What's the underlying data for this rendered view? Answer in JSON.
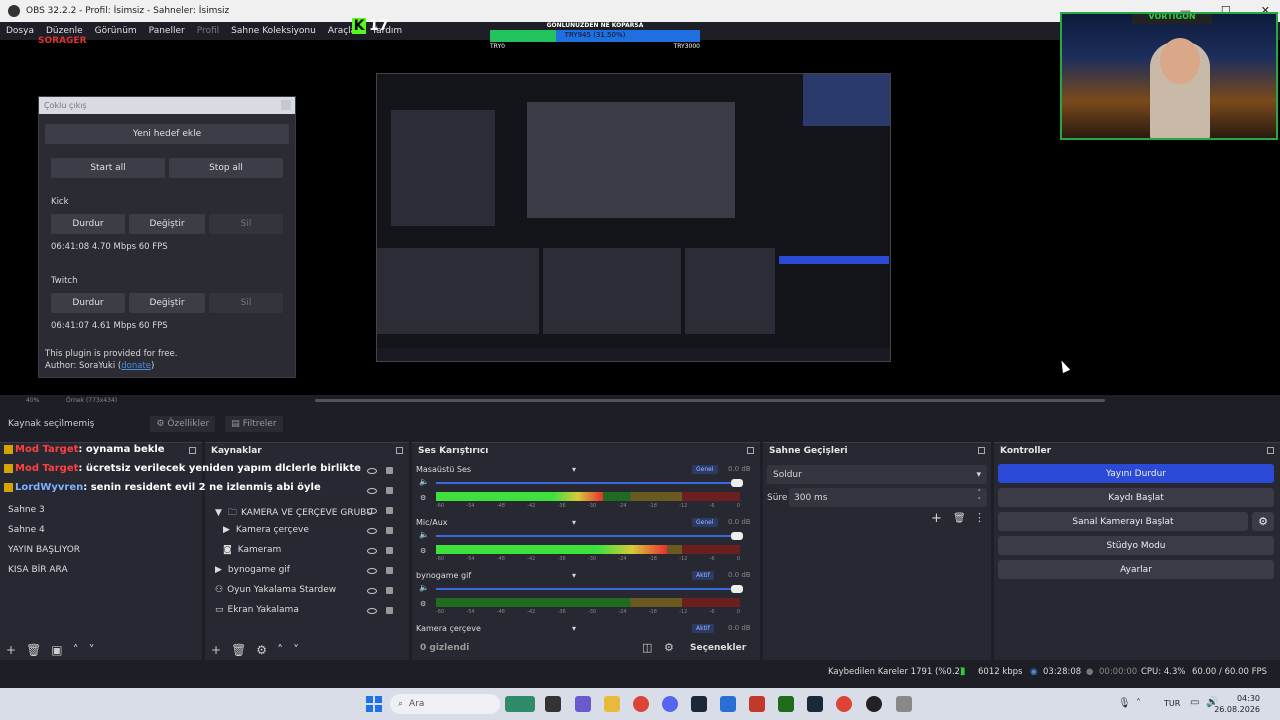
{
  "window": {
    "title": "OBS 32.2.2 - Profil: İsimsiz - Sahneler: İsimsiz"
  },
  "menu": [
    "Dosya",
    "Düzenle",
    "Görünüm",
    "Paneller",
    "Profil",
    "Sahne Koleksiyonu",
    "Araçlar",
    "Yardım"
  ],
  "overlay": {
    "watermark": "SORAGER",
    "kick_count": "17",
    "goal_title": "GÖNLÜNÜZDEN NE KOPARSA",
    "goal_bar_text": "TRY945 (31.50%)",
    "goal_fraction": 0.315,
    "goal_start": "TRY0",
    "goal_end": "TRY3000",
    "webcam_label": "VORTIGON"
  },
  "multi_output": {
    "title": "Çoklu çıkış",
    "add_target": "Yeni hedef ekle",
    "start_all": "Start all",
    "stop_all": "Stop all",
    "targets": [
      {
        "name": "Kick",
        "stop": "Durdur",
        "edit": "Değiştir",
        "delete": "Sil",
        "status": "06:41:08  4.70 Mbps  60 FPS"
      },
      {
        "name": "Twitch",
        "stop": "Durdur",
        "edit": "Değiştir",
        "delete": "Sil",
        "status": "06:41:07  4.61 Mbps  60 FPS"
      }
    ],
    "footer_line1": "This plugin is provided for free.",
    "footer_author": "Author: SoraYuki (",
    "footer_link": "donate",
    "footer_close": ")"
  },
  "zoom": {
    "level": "40%",
    "canvas": "Örnek (773x434)"
  },
  "source_toolbar": {
    "no_source": "Kaynak seçilmemiş",
    "properties": "Özellikler",
    "filters": "Filtreler"
  },
  "chat": [
    {
      "user": "Mod Target",
      "msg": ": oynama bekle"
    },
    {
      "user": "Mod Target",
      "msg": ": ücretsiz verilecek yeniden yapım dlclerle birlikte"
    },
    {
      "user": "LordWyvren",
      "msg": ": senin resident evil 2 ne izlenmiş abi öyle"
    }
  ],
  "scenes": [
    "Sahne 3",
    "Sahne 4",
    "YAYIN BAŞLIYOR",
    "KISA BİR ARA"
  ],
  "sources": {
    "title": "Kaynaklar",
    "items": [
      "KAMERA VE ÇERÇEVE GRUBU",
      "Kamera çerçeve",
      "Kameram",
      "bynogame gif",
      "Oyun Yakalama Stardew",
      "Ekran Yakalama"
    ]
  },
  "mixer": {
    "title": "Ses Karıştırıcı",
    "channels": [
      {
        "name": "Masaüstü Ses",
        "tag": "Genel",
        "db": "0.0 dB",
        "level": 0.55
      },
      {
        "name": "Mic/Aux",
        "tag": "Genel",
        "db": "0.0 dB",
        "level": 0.76
      },
      {
        "name": "bynogame gif",
        "tag": "Aktif",
        "db": "0.0 dB",
        "level": 0.0
      },
      {
        "name": "Kamera çerçeve",
        "tag": "Aktif",
        "db": "0.0 dB",
        "level": 0.0
      }
    ],
    "ticks": [
      "-60",
      "-54",
      "-48",
      "-42",
      "-36",
      "-30",
      "-24",
      "-18",
      "-12",
      "-6",
      "0"
    ],
    "hidden": "0 gizlendi",
    "options": "Seçenekler"
  },
  "transitions": {
    "title": "Sahne Geçişleri",
    "selected": "Soldur",
    "duration_label": "Süre",
    "duration": "300 ms"
  },
  "controls": {
    "title": "Kontroller",
    "stop_stream": "Yayını Durdur",
    "start_record": "Kaydı Başlat",
    "virtual_cam": "Sanal Kamerayı Başlat",
    "studio_mode": "Stüdyo Modu",
    "settings": "Ayarlar"
  },
  "status": {
    "dropped": "Kaybedilen Kareler 1791 (%0.2)",
    "bitrate": "6012 kbps",
    "stream_time": "03:28:08",
    "rec_time": "00:00:00",
    "cpu": "CPU: 4.3%",
    "fps": "60.00 / 60.00 FPS"
  },
  "taskbar": {
    "search": "Ara",
    "lang": "TUR",
    "time": "04:30",
    "date": "26.08.2026"
  },
  "colors": {
    "accent": "#2b4bd6",
    "kick": "#53fc18",
    "goal_green": "#22c35a",
    "goal_blue": "#1f6fe0"
  }
}
